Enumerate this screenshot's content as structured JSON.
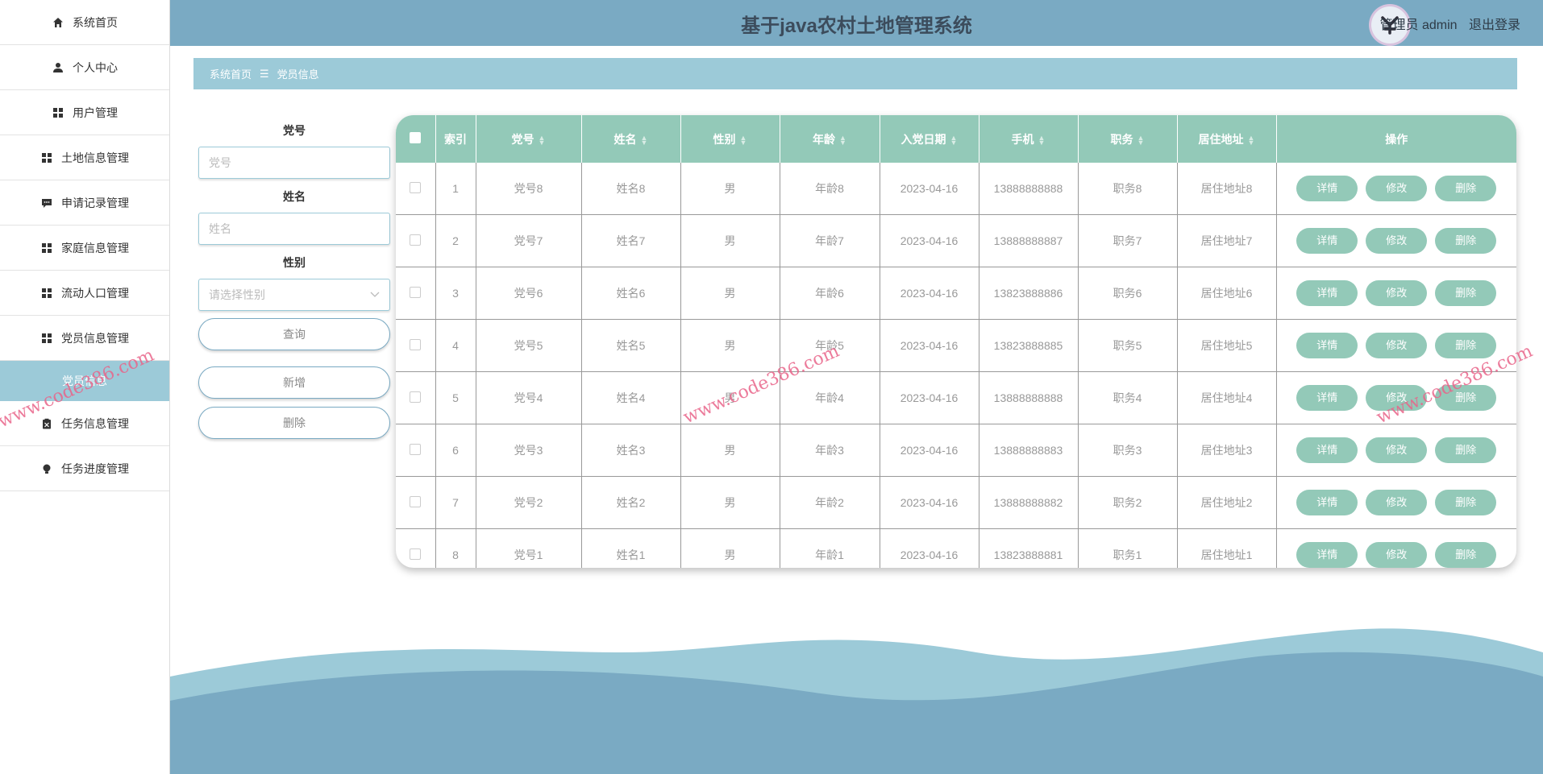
{
  "sidebar": {
    "items": [
      {
        "label": "系统首页",
        "icon": "home-icon"
      },
      {
        "label": "个人中心",
        "icon": "user-icon"
      },
      {
        "label": "用户管理",
        "icon": "grid-icon"
      },
      {
        "label": "土地信息管理",
        "icon": "grid-icon"
      },
      {
        "label": "申请记录管理",
        "icon": "chat-icon"
      },
      {
        "label": "家庭信息管理",
        "icon": "grid-icon"
      },
      {
        "label": "流动人口管理",
        "icon": "grid-icon"
      },
      {
        "label": "党员信息管理",
        "icon": "grid-icon"
      }
    ],
    "sub_item": "党员信息",
    "items_after": [
      {
        "label": "任务信息管理",
        "icon": "clipboard-icon"
      },
      {
        "label": "任务进度管理",
        "icon": "bulb-icon"
      }
    ]
  },
  "header": {
    "title": "基于java农村土地管理系统",
    "user_label": "管理员 admin",
    "logout": "退出登录"
  },
  "breadcrumb": {
    "home": "系统首页",
    "separator": "☰",
    "current": "党员信息"
  },
  "search": {
    "dangid_label": "党号",
    "dangid_placeholder": "党号",
    "name_label": "姓名",
    "name_placeholder": "姓名",
    "gender_label": "性别",
    "gender_placeholder": "请选择性别",
    "query_button": "查询",
    "add_button": "新增",
    "delete_button": "删除"
  },
  "table": {
    "headers": [
      "索引",
      "党号",
      "姓名",
      "性别",
      "年龄",
      "入党日期",
      "手机",
      "职务",
      "居住地址",
      "操作"
    ],
    "rows": [
      {
        "index": "1",
        "dangid": "党号8",
        "name": "姓名8",
        "gender": "男",
        "age": "年龄8",
        "date": "2023-04-16",
        "phone": "13888888888",
        "job": "职务8",
        "address": "居住地址8"
      },
      {
        "index": "2",
        "dangid": "党号7",
        "name": "姓名7",
        "gender": "男",
        "age": "年龄7",
        "date": "2023-04-16",
        "phone": "13888888887",
        "job": "职务7",
        "address": "居住地址7"
      },
      {
        "index": "3",
        "dangid": "党号6",
        "name": "姓名6",
        "gender": "男",
        "age": "年龄6",
        "date": "2023-04-16",
        "phone": "13823888886",
        "job": "职务6",
        "address": "居住地址6"
      },
      {
        "index": "4",
        "dangid": "党号5",
        "name": "姓名5",
        "gender": "男",
        "age": "年龄5",
        "date": "2023-04-16",
        "phone": "13823888885",
        "job": "职务5",
        "address": "居住地址5"
      },
      {
        "index": "5",
        "dangid": "党号4",
        "name": "姓名4",
        "gender": "男",
        "age": "年龄4",
        "date": "2023-04-16",
        "phone": "13888888888",
        "job": "职务4",
        "address": "居住地址4"
      },
      {
        "index": "6",
        "dangid": "党号3",
        "name": "姓名3",
        "gender": "男",
        "age": "年龄3",
        "date": "2023-04-16",
        "phone": "13888888883",
        "job": "职务3",
        "address": "居住地址3"
      },
      {
        "index": "7",
        "dangid": "党号2",
        "name": "姓名2",
        "gender": "男",
        "age": "年龄2",
        "date": "2023-04-16",
        "phone": "13888888882",
        "job": "职务2",
        "address": "居住地址2"
      },
      {
        "index": "8",
        "dangid": "党号1",
        "name": "姓名1",
        "gender": "男",
        "age": "年龄1",
        "date": "2023-04-16",
        "phone": "13823888881",
        "job": "职务1",
        "address": "居住地址1"
      }
    ],
    "actions": {
      "detail": "详情",
      "edit": "修改",
      "delete": "删除"
    }
  },
  "watermark": "www.code386.com",
  "colors": {
    "primary": "#7aaac3",
    "light": "#9ccad8",
    "table_head": "#93c9b8"
  }
}
